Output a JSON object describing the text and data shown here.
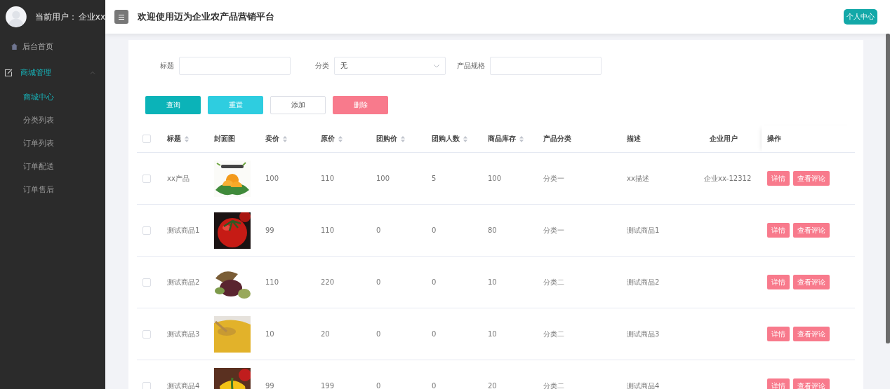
{
  "sidebar": {
    "user_label": "当前用户：",
    "user_name": "企业xx",
    "menu": [
      {
        "label": "后台首页",
        "kind": "link",
        "selected": false
      },
      {
        "label": "商城管理",
        "kind": "group",
        "expanded": true,
        "children": [
          {
            "label": "商城中心",
            "selected": true
          },
          {
            "label": "分类列表",
            "selected": false
          },
          {
            "label": "订单列表",
            "selected": false
          },
          {
            "label": "订单配送",
            "selected": false
          },
          {
            "label": "订单售后",
            "selected": false
          }
        ]
      }
    ]
  },
  "header": {
    "title": "欢迎使用迈为企业农产品营销平台",
    "profile_button": "个人中心"
  },
  "filters": [
    {
      "label": "标题",
      "kind": "input"
    },
    {
      "label": "分类",
      "kind": "select",
      "value": "无"
    },
    {
      "label": "产品规格",
      "kind": "input"
    }
  ],
  "buttons": [
    {
      "label": "查询",
      "kind": "primary"
    },
    {
      "label": "重置",
      "kind": "info"
    },
    {
      "label": "添加",
      "kind": "plain"
    },
    {
      "label": "删除",
      "kind": "danger"
    }
  ],
  "table": {
    "header_checked": false,
    "columns": [
      {
        "label": "标题",
        "sortable": true
      },
      {
        "label": "封面图",
        "sortable": false
      },
      {
        "label": "卖价",
        "sortable": true
      },
      {
        "label": "原价",
        "sortable": true
      },
      {
        "label": "团购价",
        "sortable": true
      },
      {
        "label": "团购人数",
        "sortable": true
      },
      {
        "label": "商品库存",
        "sortable": true
      },
      {
        "label": "产品分类",
        "sortable": false
      },
      {
        "label": "描述",
        "sortable": false
      },
      {
        "label": "企业用户",
        "sortable": false
      },
      {
        "label": "操作",
        "sortable": false
      }
    ],
    "rows": [
      {
        "checked": false,
        "cells": [
          "xx产品",
          {
            "kind": "picture"
          },
          "100",
          "110",
          "100",
          "5",
          "100",
          "分类一",
          "xx描述",
          "企业xx-12312"
        ],
        "actions": [
          "详情",
          "查看评论"
        ]
      },
      {
        "checked": false,
        "cells": [
          "测试商品1",
          {
            "kind": "picture"
          },
          "99",
          "110",
          "0",
          "0",
          "80",
          "分类一",
          "测试商品1"
        ],
        "actions": [
          "详情",
          "查看评论"
        ]
      },
      {
        "checked": false,
        "cells": [
          "测试商品2",
          {
            "kind": "picture"
          },
          "110",
          "220",
          "0",
          "0",
          "10",
          "分类二",
          "测试商品2"
        ],
        "actions": [
          "详情",
          "查看评论"
        ]
      },
      {
        "checked": false,
        "cells": [
          "测试商品3",
          {
            "kind": "picture"
          },
          "10",
          "20",
          "0",
          "0",
          "10",
          "分类二",
          "测试商品3"
        ],
        "actions": [
          "详情",
          "查看评论"
        ]
      },
      {
        "checked": false,
        "cells": [
          "测试商品4",
          {
            "kind": "picture"
          },
          "99",
          "199",
          "0",
          "0",
          "20",
          "分类二",
          "测试商品4"
        ],
        "actions": [
          "详情",
          "查看评论"
        ]
      }
    ]
  }
}
